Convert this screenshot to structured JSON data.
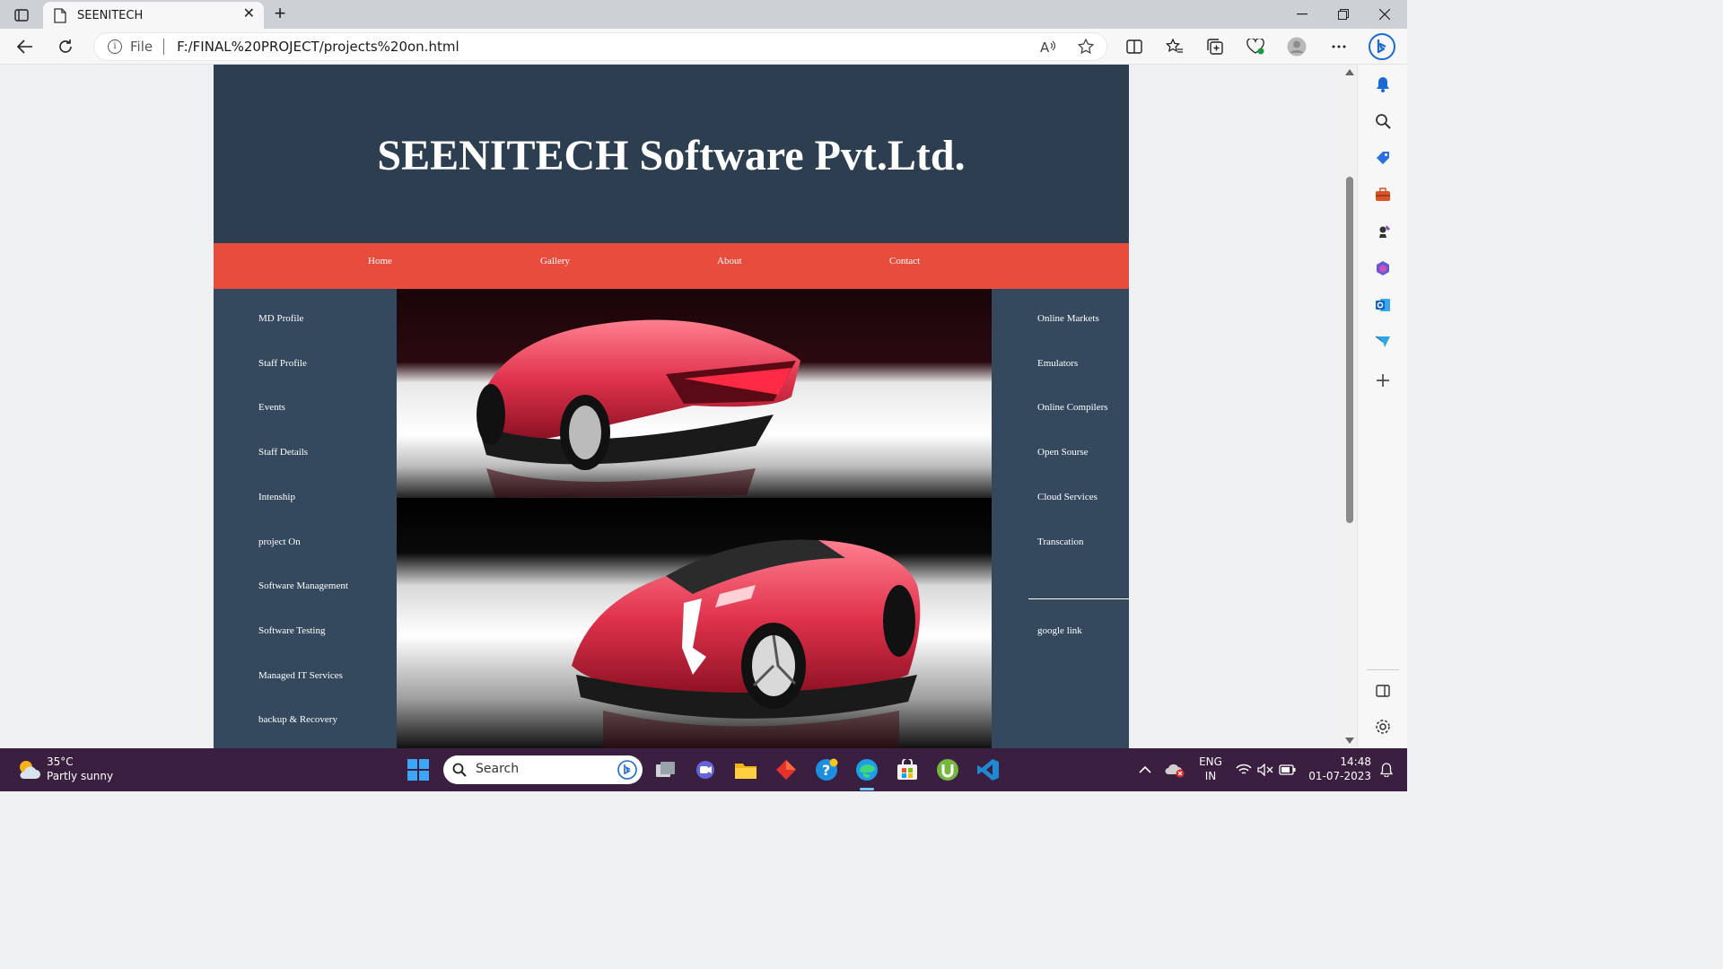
{
  "browser": {
    "tab_title": "SEENITECH",
    "address_scheme": "File",
    "address_url": "F:/FINAL%20PROJECT/projects%20on.html"
  },
  "site": {
    "title": "SEENITECH Software Pvt.Ltd.",
    "nav": [
      "Home",
      "Gallery",
      "About",
      "Contact"
    ],
    "left_menu": [
      "MD Profile",
      "Staff Profile",
      "Events",
      "Staff Details",
      "Intenship",
      "project On",
      "Software Management",
      "Software Testing",
      "Managed IT Services",
      "backup & Recovery"
    ],
    "right_menu": [
      "Online Markets",
      "Emulators",
      "Online Compilers",
      "Open Sourse",
      "Cloud Services",
      "Transcation"
    ],
    "right_bottom_link": "google link",
    "colors": {
      "header": "#2c3e50",
      "nav": "#e74c3c",
      "body": "#34495e"
    }
  },
  "taskbar": {
    "weather_temp": "35°C",
    "weather_desc": "Partly sunny",
    "search_label": "Search",
    "lang_top": "ENG",
    "lang_bottom": "IN",
    "time": "14:48",
    "date": "01-07-2023"
  }
}
